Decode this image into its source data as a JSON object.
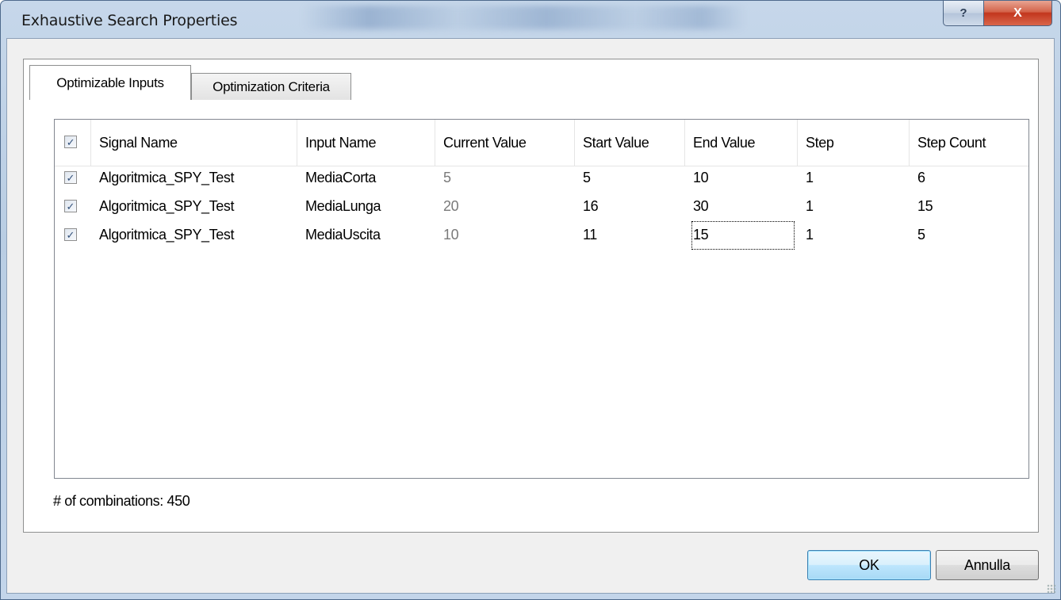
{
  "window": {
    "title": "Exhaustive Search Properties",
    "help_glyph": "?",
    "close_glyph": "X"
  },
  "tabs": [
    {
      "label": "Optimizable Inputs",
      "active": true
    },
    {
      "label": "Optimization Criteria",
      "active": false
    }
  ],
  "grid": {
    "select_all_checked": true,
    "columns": [
      "Signal Name",
      "Input Name",
      "Current Value",
      "Start Value",
      "End Value",
      "Step",
      "Step Count"
    ],
    "rows": [
      {
        "checked": true,
        "signal": "Algoritmica_SPY_Test",
        "input": "MediaCorta",
        "current": "5",
        "start": "5",
        "end": "10",
        "step": "1",
        "count": "6"
      },
      {
        "checked": true,
        "signal": "Algoritmica_SPY_Test",
        "input": "MediaLunga",
        "current": "20",
        "start": "16",
        "end": "30",
        "step": "1",
        "count": "15"
      },
      {
        "checked": true,
        "signal": "Algoritmica_SPY_Test",
        "input": "MediaUscita",
        "current": "10",
        "start": "11",
        "end": "15",
        "step": "1",
        "count": "5"
      }
    ]
  },
  "footer": {
    "combinations_text": "# of combinations: 450"
  },
  "buttons": {
    "ok": "OK",
    "cancel": "Annulla"
  },
  "icons": {
    "checkbox_glyph": "✓"
  }
}
